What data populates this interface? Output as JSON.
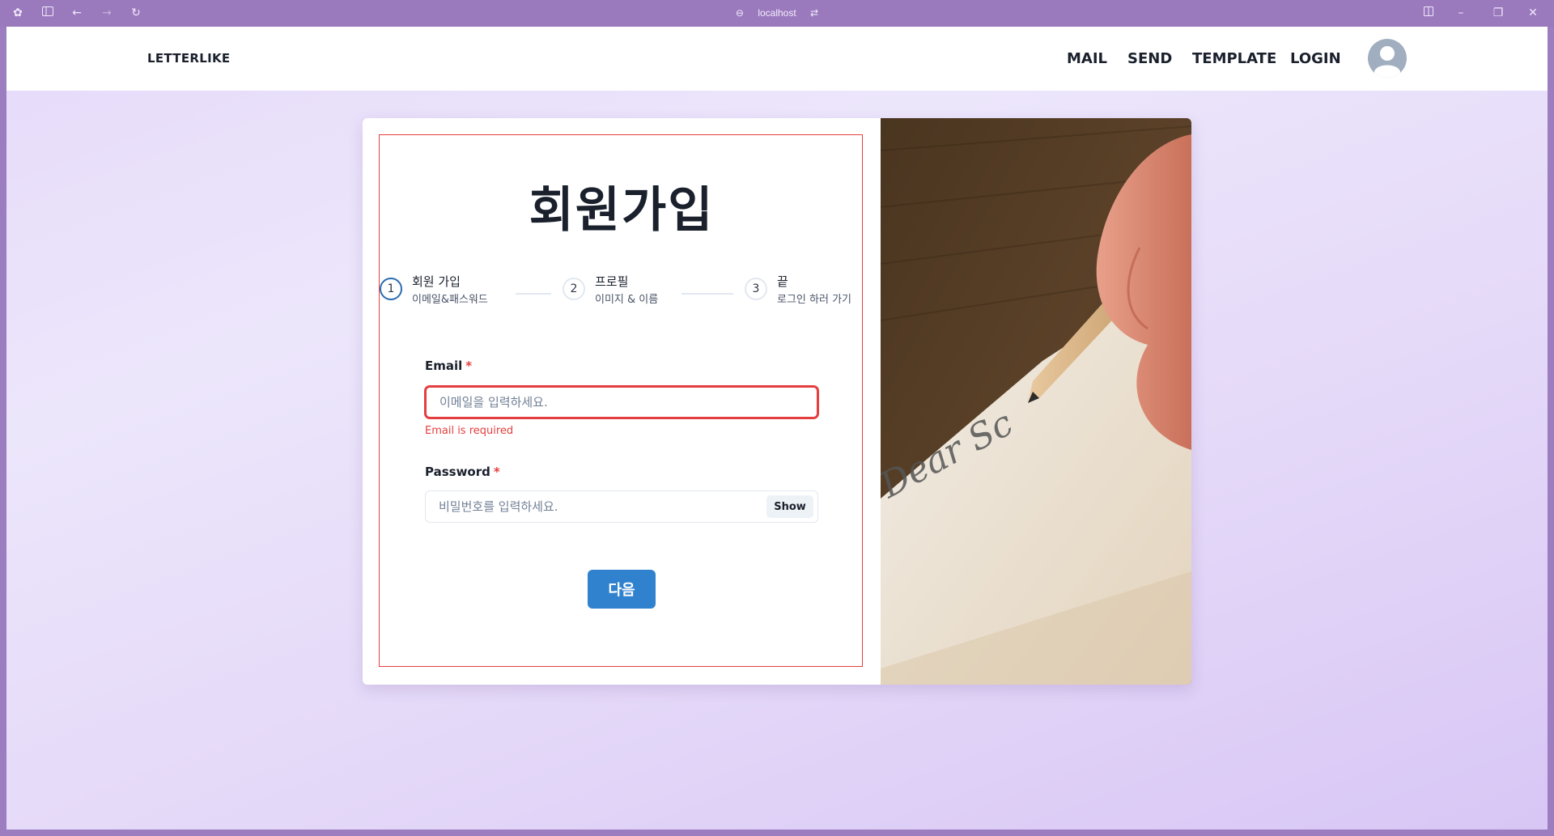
{
  "browser": {
    "url": "localhost"
  },
  "navbar": {
    "brand": "LETTERLIKE",
    "links": [
      "MAIL",
      "SEND",
      "TEMPLATE",
      "LOGIN"
    ]
  },
  "form": {
    "title": "회원가입",
    "steps": [
      {
        "number": "1",
        "title": "회원 가입",
        "description": "이메일&패스워드",
        "active": true
      },
      {
        "number": "2",
        "title": "프로필",
        "description": "이미지 & 이름",
        "active": false
      },
      {
        "number": "3",
        "title": "끝",
        "description": "로그인 하러 가기",
        "active": false
      }
    ],
    "email": {
      "label": "Email",
      "required_mark": "*",
      "placeholder": "이메일을 입력하세요.",
      "value": "",
      "error": "Email is required"
    },
    "password": {
      "label": "Password",
      "required_mark": "*",
      "placeholder": "비밀번호를 입력하세요.",
      "value": "",
      "toggle_label": "Show"
    },
    "next_button": "다음"
  },
  "colors": {
    "accent": "#3182ce",
    "error": "#e53e3e",
    "active_step": "#2b6cb0",
    "browser_chrome": "#9a79bd"
  }
}
